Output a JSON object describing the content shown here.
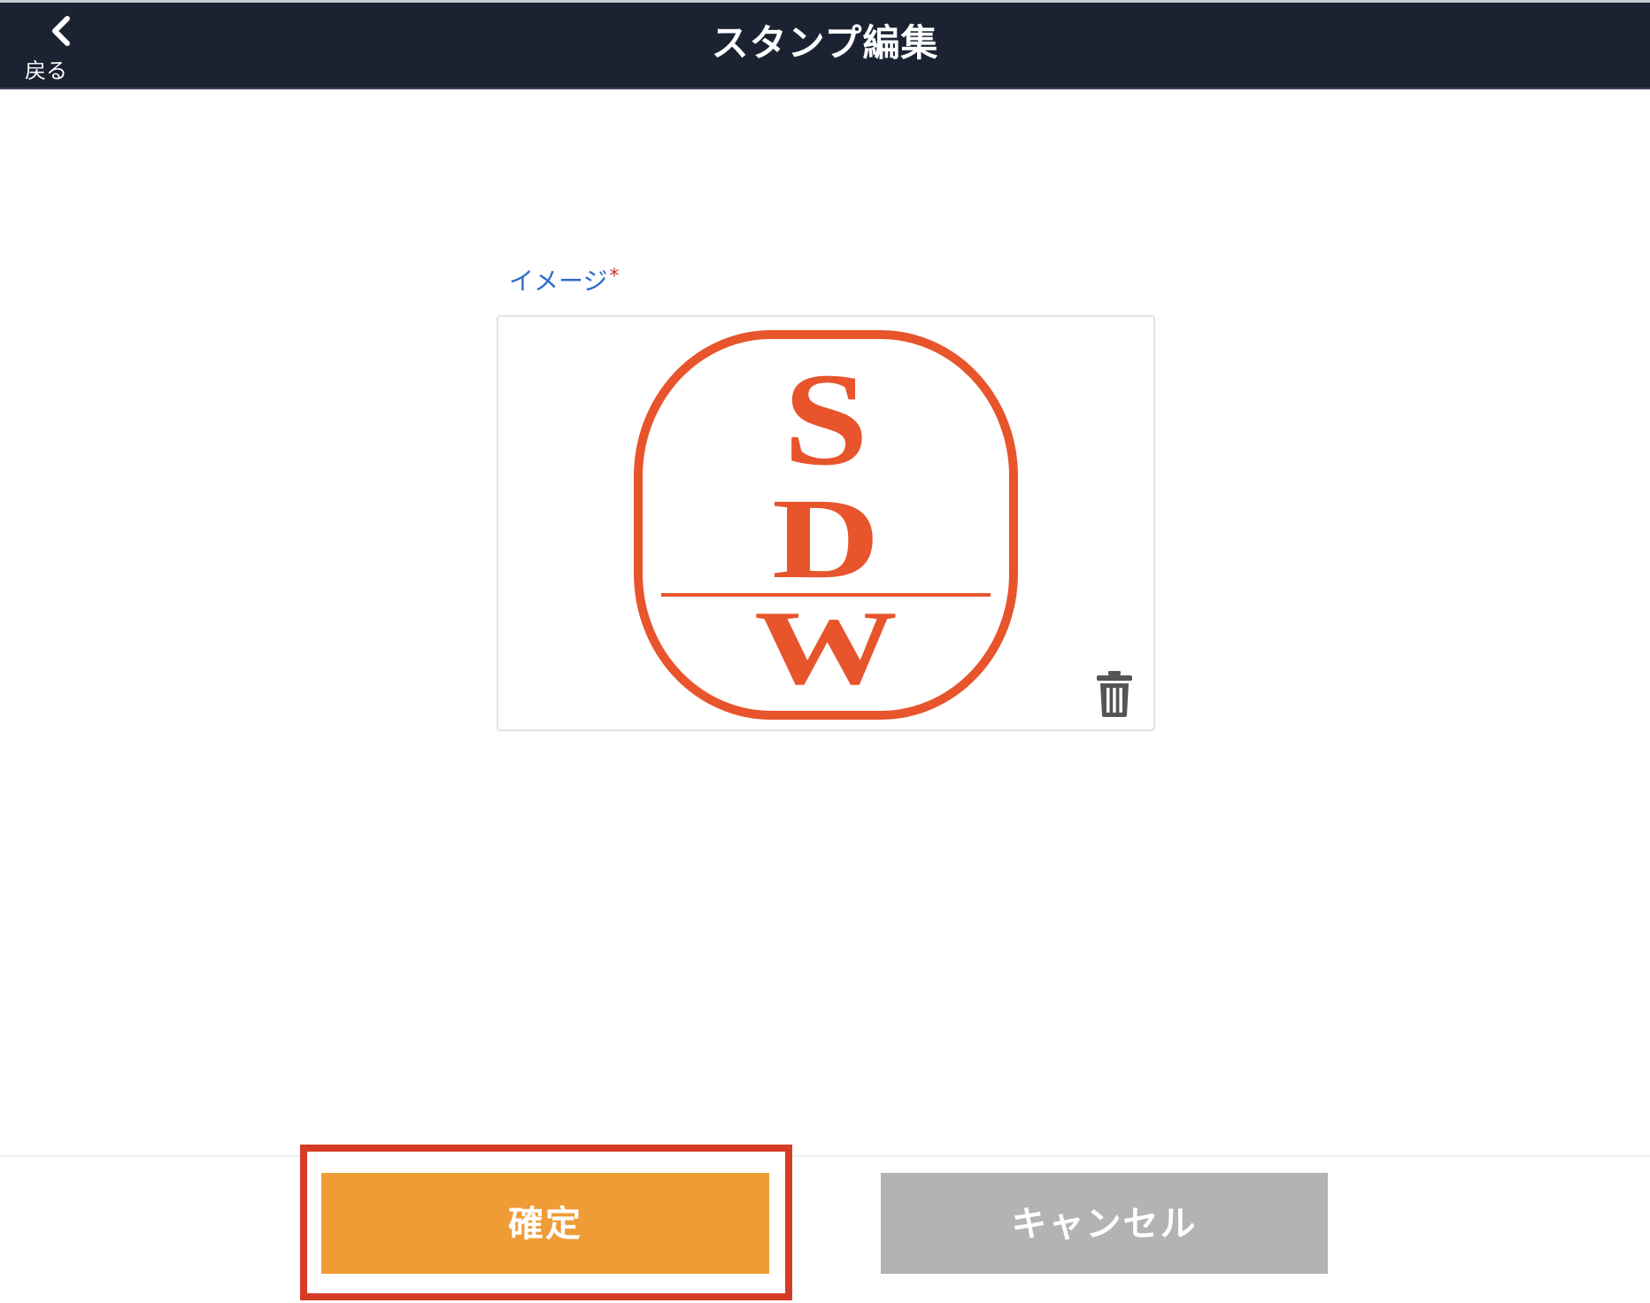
{
  "header": {
    "back_label": "戻る",
    "title": "スタンプ編集"
  },
  "field": {
    "label": "イメージ",
    "required_mark": "*"
  },
  "stamp": {
    "letters": [
      "S",
      "D",
      "W"
    ],
    "color": "#e8542b"
  },
  "icons": {
    "back": "chevron-left-icon",
    "delete": "trash-icon"
  },
  "footer": {
    "confirm_label": "確定",
    "cancel_label": "キャンセル"
  },
  "colors": {
    "header_bg": "#1b2333",
    "label_blue": "#2f6bc9",
    "confirm_bg": "#ef9c37",
    "cancel_bg": "#b3b3b3",
    "highlight_border": "#d63b26"
  }
}
